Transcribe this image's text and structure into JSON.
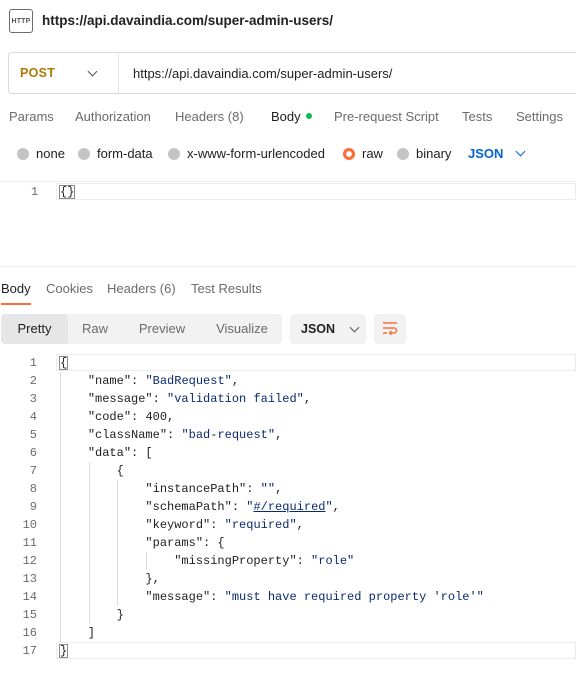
{
  "title": {
    "icon_text": "HTTP",
    "text": "https://api.davaindia.com/super-admin-users/"
  },
  "request": {
    "method": "POST",
    "url": "https://api.davaindia.com/super-admin-users/"
  },
  "request_tabs": {
    "params": "Params",
    "authorization": "Authorization",
    "headers_label": "Headers",
    "headers_count": "(8)",
    "body": "Body",
    "pre_request": "Pre-request Script",
    "tests": "Tests",
    "settings": "Settings"
  },
  "body_types": {
    "none": "none",
    "form_data": "form-data",
    "urlencoded": "x-www-form-urlencoded",
    "raw": "raw",
    "binary": "binary",
    "format": "JSON"
  },
  "request_body": {
    "line_number": "1",
    "code": "{}"
  },
  "response_tabs": {
    "body": "Body",
    "cookies": "Cookies",
    "headers_label": "Headers",
    "headers_count": "(6)",
    "test_results": "Test Results"
  },
  "response_toolbar": {
    "pretty": "Pretty",
    "raw": "Raw",
    "preview": "Preview",
    "visualize": "Visualize",
    "format": "JSON"
  },
  "response_lines": [
    "1",
    "2",
    "3",
    "4",
    "5",
    "6",
    "7",
    "8",
    "9",
    "10",
    "11",
    "12",
    "13",
    "14",
    "15",
    "16",
    "17"
  ],
  "response_json": {
    "name_key": "\"name\"",
    "name_val": "\"BadRequest\"",
    "message_key": "\"message\"",
    "message_val": "\"validation failed\"",
    "code_key": "\"code\"",
    "code_val": "400",
    "classname_key": "\"className\"",
    "classname_val": "\"bad-request\"",
    "data_key": "\"data\"",
    "instancepath_key": "\"instancePath\"",
    "instancepath_val": "\"\"",
    "schemapath_key": "\"schemaPath\"",
    "schemapath_q1": "\"",
    "schemapath_val": "#/required",
    "schemapath_q2": "\"",
    "keyword_key": "\"keyword\"",
    "keyword_val": "\"required\"",
    "params_key": "\"params\"",
    "missing_key": "\"missingProperty\"",
    "missing_val": "\"role\"",
    "msg2_key": "\"message\"",
    "msg2_val": "\"must have required property 'role'\""
  },
  "colors": {
    "accent": "#ff6c37",
    "method": "#ad7a03",
    "link": "#0265d2",
    "dot": "#0cbb52"
  }
}
